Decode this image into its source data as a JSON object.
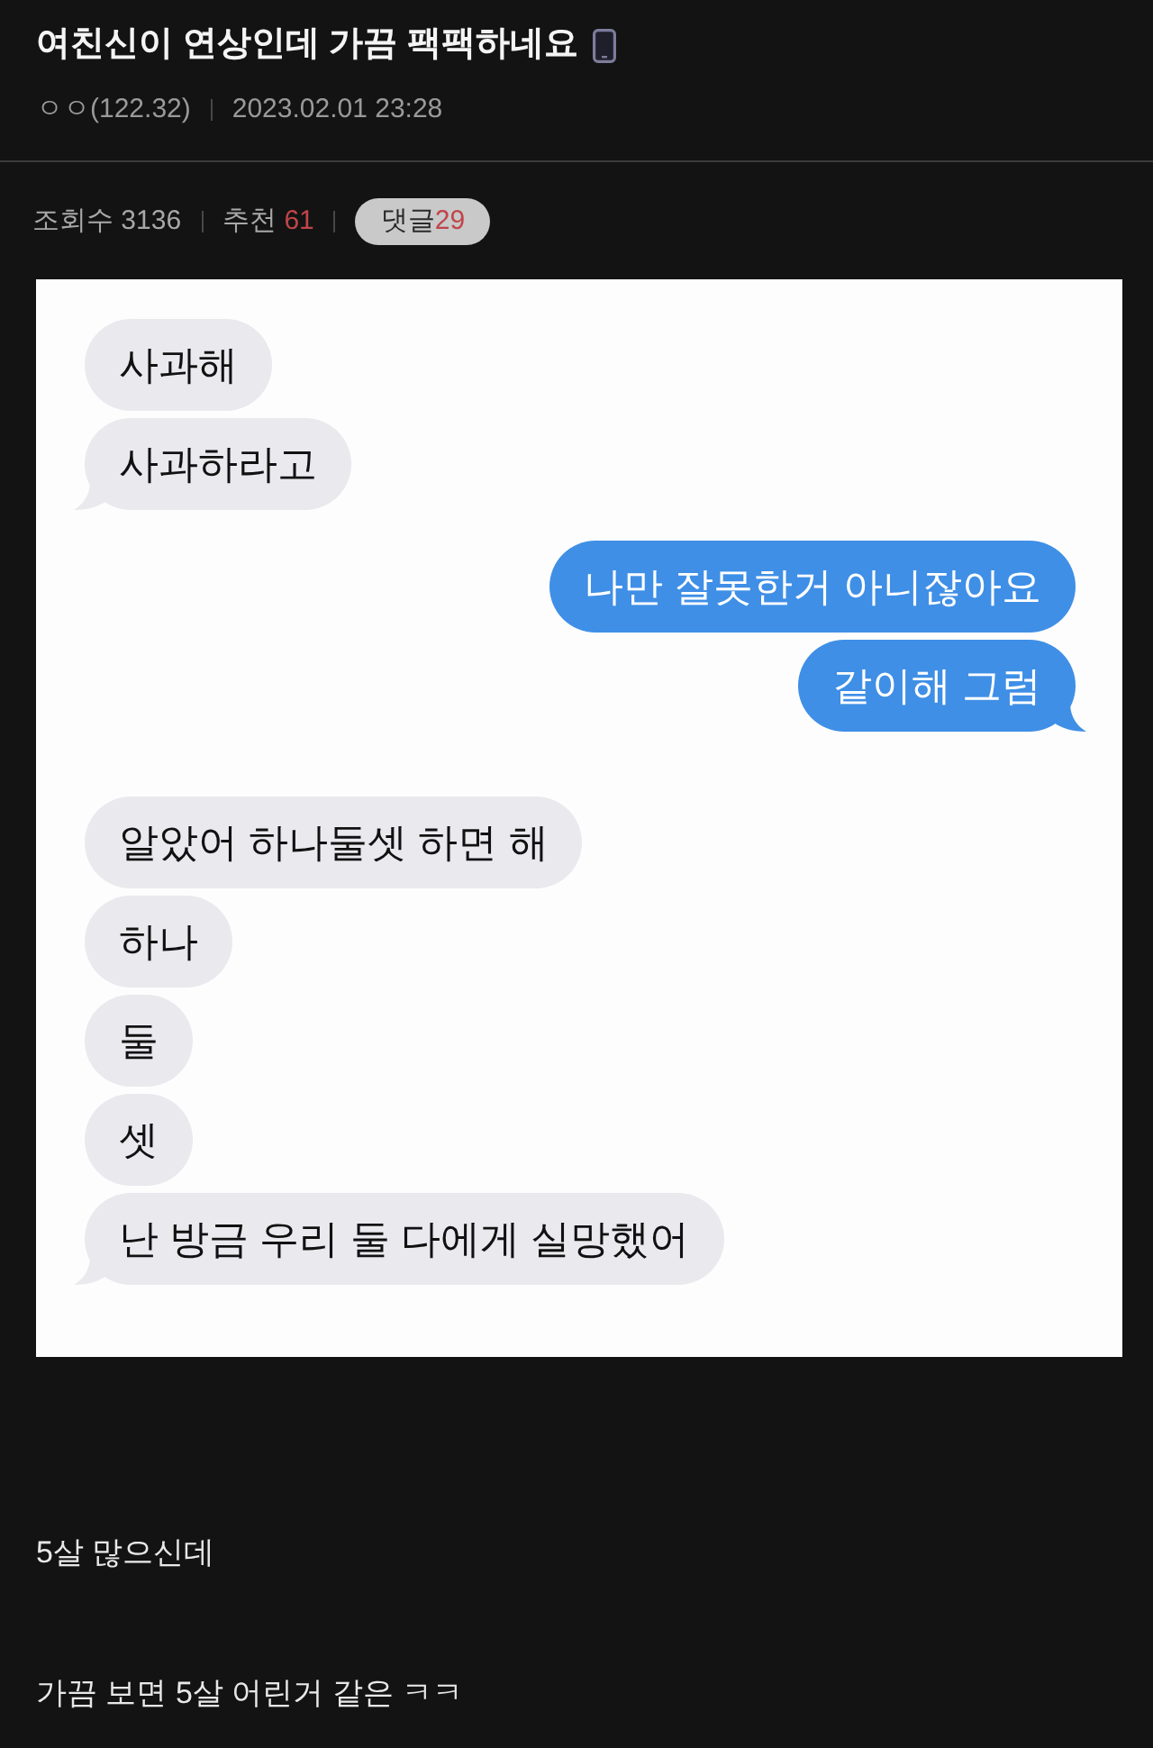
{
  "post": {
    "title": "여친신이 연상인데 가끔 팩팩하네요",
    "mobile": true,
    "author": "ㅇㅇ(122.32)",
    "date": "2023.02.01 23:28"
  },
  "stats": {
    "views": {
      "label": "조회수",
      "value": "3136"
    },
    "recommends": {
      "label": "추천",
      "value": "61"
    },
    "comments": {
      "label": "댓글",
      "value": "29"
    }
  },
  "chat_image": {
    "messages": [
      {
        "kind": "received",
        "text": "사과해",
        "tail": false
      },
      {
        "kind": "received",
        "text": "사과하라고",
        "tail": true
      },
      {
        "kind": "sent",
        "text": "나만 잘못한거 아니잖아요",
        "tail": false
      },
      {
        "kind": "sent",
        "text": "같이해 그럼",
        "tail": true
      },
      {
        "kind": "received",
        "text": "알았어 하나둘셋 하면 해",
        "tail": false
      },
      {
        "kind": "received",
        "text": "하나",
        "tail": false
      },
      {
        "kind": "received",
        "text": "둘",
        "tail": false
      },
      {
        "kind": "received",
        "text": "셋",
        "tail": false
      },
      {
        "kind": "received",
        "text": "난 방금 우리 둘 다에게 실망했어",
        "tail": true
      }
    ]
  },
  "body": [
    "5살 많으신데",
    "가끔 보면 5살 어린거 같은 ㅋㅋ"
  ]
}
